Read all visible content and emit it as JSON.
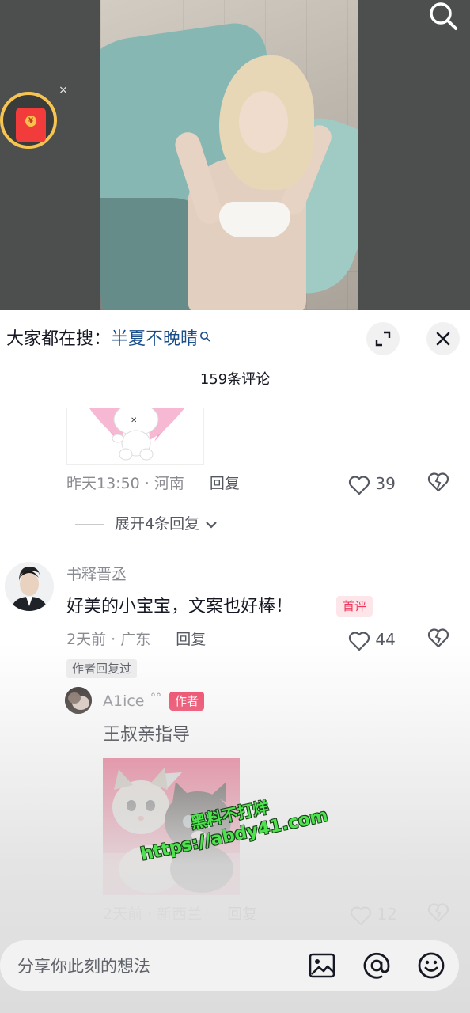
{
  "video": {
    "icons": {
      "search": "search-icon",
      "red_packet": "red-packet-icon",
      "close": "close-icon"
    },
    "red_packet_coin": "¥",
    "red_packet_close": "×"
  },
  "trending": {
    "prefix": "大家都在搜：",
    "keyword": "半夏不晚晴",
    "keyword_icon": "search-icon"
  },
  "panel": {
    "comment_count": "159条评论",
    "expand_icon": "expand-icon",
    "close_icon": "close-icon"
  },
  "comments": [
    {
      "meta_time_location": "昨天13:50 · 河南",
      "reply_label": "回复",
      "likes": "39",
      "sticker_icon": "bunny-sticker",
      "expand_label": "展开4条回复"
    },
    {
      "username": "书释晋丞",
      "text": "好美的小宝宝，文案也好棒！",
      "badge": "首评",
      "meta_time_location": "2天前 · 广东",
      "reply_label": "回复",
      "likes": "44",
      "author_replied": "作者回复过",
      "reply": {
        "username": "A1ice",
        "username_suffix": "°°",
        "author_tag": "作者",
        "text": "王叔亲指导",
        "image": "kittens-photo",
        "meta_time_location": "2天前 · 新西兰",
        "reply_label": "回复",
        "likes": "12"
      }
    }
  ],
  "watermark": {
    "line1": "黑料不打烊",
    "line2": "https://abdy41.com"
  },
  "input": {
    "placeholder": "分享你此刻的想法",
    "icons": [
      "image-icon",
      "at-icon",
      "emoji-icon"
    ]
  },
  "colors": {
    "accent_red": "#f1365b",
    "link_blue": "#1a4f8c",
    "meta_gray": "#8a8b91"
  }
}
